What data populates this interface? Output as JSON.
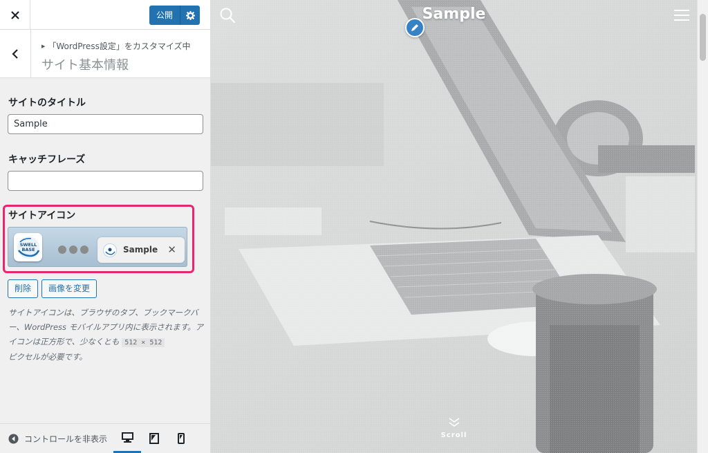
{
  "header": {
    "publish_label": "公開"
  },
  "section": {
    "breadcrumb": "「WordPress設定」をカスタマイズ中",
    "title": "サイト基本情報"
  },
  "site_title_control": {
    "label": "サイトのタイトル",
    "value": "Sample"
  },
  "tagline_control": {
    "label": "キャッチフレーズ",
    "value": ""
  },
  "site_icon_control": {
    "label": "サイトアイコン",
    "icon_text_line1": "SWELL",
    "icon_text_line2": "BASE",
    "tab_title": "Sample",
    "tab_close": "✕",
    "remove_label": "削除",
    "change_label": "画像を変更",
    "description": "サイトアイコンは、ブラウザのタブ、ブックマークバー、WordPress モバイルアプリ内に表示されます。アイコンは正方形で、少なくとも",
    "size_code": "512 × 512",
    "description_tail": "ピクセルが必要です。"
  },
  "footer": {
    "collapse_label": "コントロールを非表示",
    "devices": [
      "desktop-icon",
      "tablet-icon",
      "mobile-icon"
    ],
    "active_device": "desktop"
  },
  "preview": {
    "site_title": "Sample",
    "scroll_label": "Scroll"
  },
  "colors": {
    "accent": "#2271b1",
    "highlight": "#e6266e",
    "edit_shortcut": "#3582c4"
  }
}
